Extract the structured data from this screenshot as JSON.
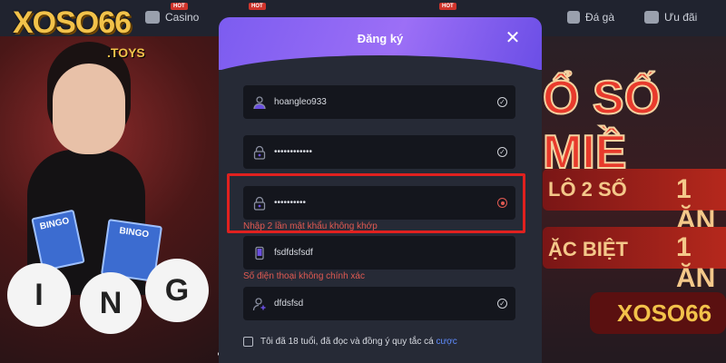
{
  "site": {
    "logo_text": "XOSO66",
    "logo_sub": ".TOYS",
    "nav": [
      {
        "label": "Casino",
        "hot": "HOT"
      },
      {
        "label": "Đá gà"
      },
      {
        "label": "Ưu đãi"
      }
    ],
    "hot_badges": [
      "HOT",
      "HOT",
      "HOT"
    ]
  },
  "banner": {
    "bingo_letters": [
      "I",
      "N",
      "G"
    ],
    "bingo_card_label": "BINGO",
    "headline": "Ổ SỐ MIỀ",
    "row1_left": "LÔ 2 SỐ",
    "row1_right": "1 ĂN",
    "row2_left": "ẶC BIỆT",
    "row2_right": "1 ĂN",
    "footer_logo": "XOSO66"
  },
  "modal": {
    "title": "Đăng ký",
    "fields": [
      {
        "value": "hoangleo933",
        "icon": "user-icon",
        "status": "valid"
      },
      {
        "value": "••••••••••••",
        "icon": "lock-icon",
        "status": "valid"
      },
      {
        "value": "••••••••••",
        "icon": "lock-icon",
        "status": "error"
      },
      {
        "value": "fsdfdsfsdf",
        "icon": "phone-icon",
        "status": "error"
      },
      {
        "value": "dfdsfsd",
        "icon": "add-user-icon",
        "status": "valid"
      }
    ],
    "errors": {
      "confirm_password": "Nhập 2 lần mật khẩu không khớp",
      "phone": "Số điện thoại không chính xác"
    },
    "terms_text": "Tôi đã 18 tuổi, đã đọc và đồng ý quy tắc cá",
    "terms_link": "cược"
  },
  "colors": {
    "header_gradient_start": "#7c5cf0",
    "error": "#e05a52",
    "highlight": "#e0211f",
    "link": "#5f8cff"
  }
}
